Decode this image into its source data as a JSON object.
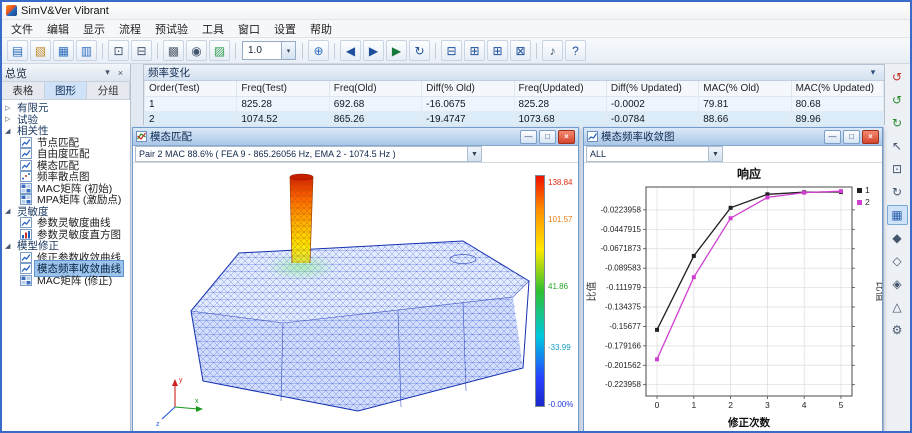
{
  "window": {
    "title": "SimV&Ver Vibrant"
  },
  "menubar": {
    "items": [
      "文件",
      "编辑",
      "显示",
      "流程",
      "预试验",
      "工具",
      "窗口",
      "设置",
      "帮助"
    ]
  },
  "toolbar": {
    "zoom_value": "1.0",
    "groups_left": [
      [
        "new-project-icon",
        "open-project-icon",
        "save-icon",
        "save-all-icon"
      ],
      [
        "display-window-icon",
        "dual-display-icon"
      ],
      [
        "print-icon",
        "snapshot-icon",
        "chart-window-icon"
      ]
    ],
    "groups_right": [
      [
        "fit-view-icon"
      ],
      [
        "prev-step-icon",
        "next-step-icon",
        "run-analysis-icon",
        "refresh-icon"
      ],
      [
        "layout-tile-horizontal-icon",
        "layout-tile-vertical-icon",
        "layout-grid-icon",
        "layout-cascade-icon"
      ],
      [
        "volume-icon",
        "help-icon"
      ]
    ]
  },
  "sidebar": {
    "title": "总览",
    "tabs": [
      {
        "label": "表格",
        "active": false
      },
      {
        "label": "图形",
        "active": true
      },
      {
        "label": "分组",
        "active": false
      }
    ],
    "tree": [
      {
        "label": "有限元",
        "type": "group",
        "expanded": false
      },
      {
        "label": "试验",
        "type": "group",
        "expanded": false
      },
      {
        "label": "相关性",
        "type": "group",
        "expanded": true
      },
      {
        "label": "节点匹配",
        "type": "item",
        "icon": "curve-icon"
      },
      {
        "label": "自由度匹配",
        "type": "item",
        "icon": "curve-icon"
      },
      {
        "label": "模态匹配",
        "type": "item",
        "icon": "curve-icon"
      },
      {
        "label": "频率散点图",
        "type": "item",
        "icon": "scatter-icon"
      },
      {
        "label": "MAC矩阵 (初始)",
        "type": "item",
        "icon": "matrix-icon"
      },
      {
        "label": "MPA矩阵 (激励点)",
        "type": "item",
        "icon": "matrix-icon"
      },
      {
        "label": "灵敏度",
        "type": "group",
        "expanded": true
      },
      {
        "label": "参数灵敏度曲线",
        "type": "item",
        "icon": "curve-icon"
      },
      {
        "label": "参数灵敏度直方图",
        "type": "item",
        "icon": "histogram-icon"
      },
      {
        "label": "模型修正",
        "type": "group",
        "expanded": true
      },
      {
        "label": "修正参数收敛曲线",
        "type": "item",
        "icon": "curve-icon"
      },
      {
        "label": "模态频率收敛曲线",
        "type": "item",
        "icon": "curve-icon",
        "selected": true
      },
      {
        "label": "MAC矩阵 (修正)",
        "type": "item",
        "icon": "matrix-icon"
      }
    ]
  },
  "right_toolbar": {
    "icons": [
      "reset-view-icon",
      "undo-view-icon",
      "redo-view-icon",
      "select-icon",
      "zoom-box-icon",
      "rotate-view-icon",
      "mesh-display-icon",
      "solid-display-icon",
      "wireframe-display-icon",
      "hidden-line-icon",
      "perspective-icon",
      "settings-icon"
    ],
    "active_index": 6
  },
  "freq_table": {
    "title": "频率变化",
    "columns": [
      "Order(Test)",
      "Freq(Test)",
      "Freq(Old)",
      "Diff(% Old)",
      "Freq(Updated)",
      "Diff(% Updated)",
      "MAC(% Old)",
      "MAC(% Updated)"
    ],
    "rows": [
      [
        "1",
        "825.28",
        "692.68",
        "-16.0675",
        "825.28",
        "-0.0002",
        "79.81",
        "80.68"
      ],
      [
        "2",
        "1074.52",
        "865.26",
        "-19.4747",
        "1073.68",
        "-0.0784",
        "88.66",
        "89.96"
      ]
    ]
  },
  "modal_window": {
    "title": "模态匹配",
    "pair_selector": "Pair 2 MAC 88.6% ( FEA 9 - 865.26056 Hz, EMA 2 - 1074.5 Hz )",
    "colorbar_labels": [
      {
        "text": "138.84",
        "pos": 0.03,
        "color": "#e03010"
      },
      {
        "text": "101.57",
        "pos": 0.19,
        "color": "#e87c10"
      },
      {
        "text": "41.86",
        "pos": 0.48,
        "color": "#28a428"
      },
      {
        "text": "-33.99",
        "pos": 0.74,
        "color": "#18a0c8"
      },
      {
        "text": "-0.00%",
        "pos": 0.985,
        "color": "#2038d8"
      }
    ]
  },
  "conv_window": {
    "title": "模态频率收敛图",
    "selector_value": "ALL"
  },
  "chart_data": {
    "type": "line",
    "title": "响应",
    "xlabel": "修正次数",
    "ylabel_left": "比值",
    "ylabel_right": "比值",
    "x": [
      0,
      1,
      2,
      3,
      4,
      5
    ],
    "series": [
      {
        "name": "1",
        "color": "#202020",
        "values": [
          -0.1607,
          -0.0755,
          -0.02,
          -0.0044,
          -0.002,
          -0.0018
        ]
      },
      {
        "name": "2",
        "color": "#d040d0",
        "values": [
          -0.1947,
          -0.1,
          -0.032,
          -0.008,
          -0.0025,
          -0.0008
        ]
      }
    ],
    "xticks": [
      0,
      1,
      2,
      3,
      4,
      5
    ],
    "yticks": [
      -0.0223958,
      -0.0447915,
      -0.0671873,
      -0.089583,
      -0.111979,
      -0.134375,
      -0.15677,
      -0.179166,
      -0.201562,
      -0.223958
    ],
    "ytick_labels": [
      "-0.0223958",
      "-0.0447915",
      "-0.0671873",
      "-0.089583",
      "-0.111979",
      "-0.134375",
      "-0.15677",
      "-0.179166",
      "-0.201562",
      "-0.223958"
    ],
    "xlim": [
      -0.3,
      5.3
    ],
    "ylim": [
      -0.237,
      0.004
    ],
    "grid": true,
    "legend_position": "top-right"
  }
}
